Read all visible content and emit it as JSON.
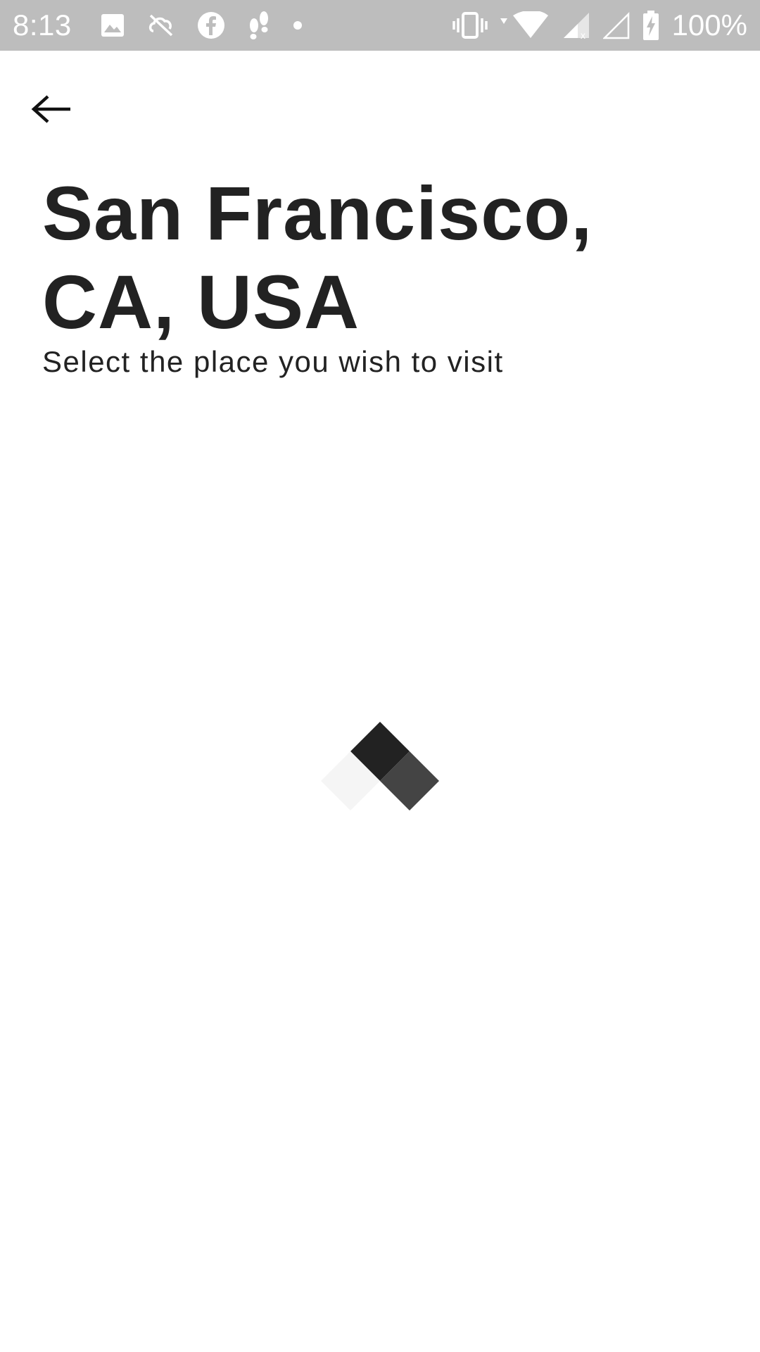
{
  "status_bar": {
    "time": "8:13",
    "battery_text": "100%",
    "left_icons": [
      "image-icon",
      "sync-disabled-icon",
      "facebook-icon",
      "footsteps-icon",
      "dot-icon"
    ],
    "right_icons": [
      "vibrate-icon",
      "wifi-icon",
      "signal-icon",
      "signal-empty-icon",
      "battery-charging-icon"
    ],
    "background_color": "#bdbdbd"
  },
  "header": {
    "back_icon": "arrow-left-icon"
  },
  "main": {
    "title": "San Francisco, CA, USA",
    "subtitle": "Select the place you wish to visit"
  },
  "loader": {
    "icon": "loading-diamond-icon",
    "colors": [
      "#222222",
      "#444444",
      "#f5f5f5"
    ]
  }
}
